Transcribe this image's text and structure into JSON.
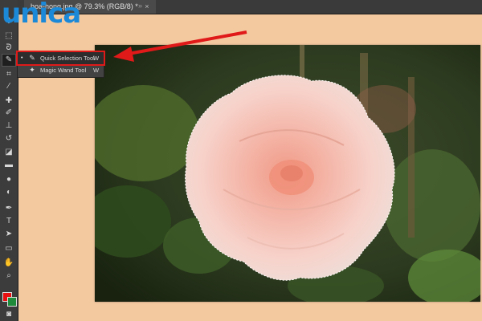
{
  "logo": {
    "text": "unica"
  },
  "document": {
    "tab_title": "hoa-hong.jpg @ 79.3% (RGB/8) *",
    "close_glyph": "×",
    "overflow_glyph": "»"
  },
  "tool_flyout": {
    "items": [
      {
        "label": "Quick Selection Tool",
        "shortcut": "W",
        "icon": "quick-selection-icon",
        "selected": true,
        "bullet": "•"
      },
      {
        "label": "Magic Wand Tool",
        "shortcut": "W",
        "icon": "magic-wand-icon",
        "selected": false,
        "bullet": ""
      }
    ]
  },
  "toolbar": {
    "tools": [
      "move-icon",
      "marquee-icon",
      "lasso-icon",
      "quick-selection-icon",
      "crop-icon",
      "eyedropper-icon",
      "healing-brush-icon",
      "brush-icon",
      "clone-stamp-icon",
      "history-brush-icon",
      "eraser-icon",
      "gradient-icon",
      "blur-icon",
      "dodge-icon",
      "pen-icon",
      "type-icon",
      "path-selection-icon",
      "rectangle-icon",
      "hand-icon",
      "zoom-icon"
    ]
  },
  "colors": {
    "foreground": "#e81010",
    "background": "#1f8a3a",
    "canvas_bg": "#f3c9a0",
    "annotation": "#e01919",
    "logo": "#1b89d8"
  }
}
